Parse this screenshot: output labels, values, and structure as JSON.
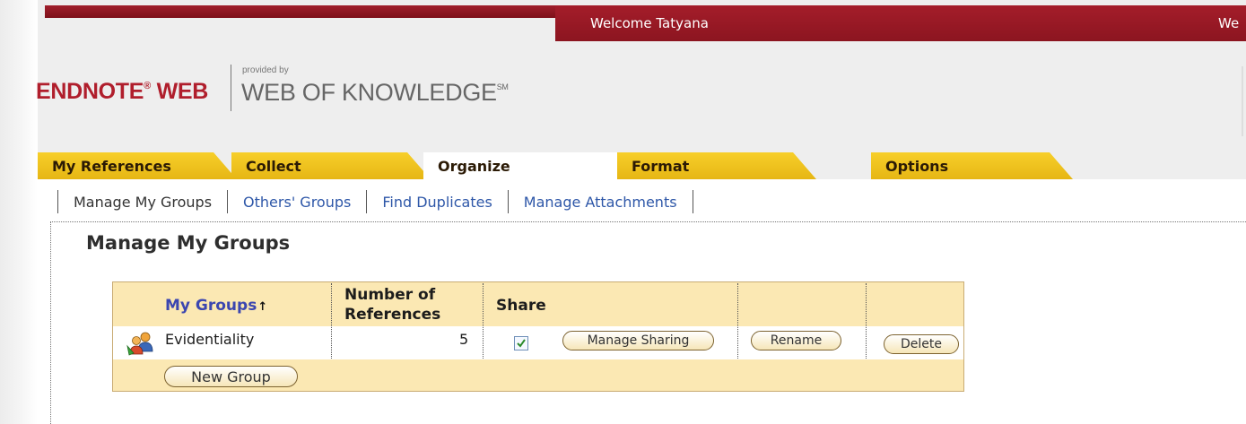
{
  "header": {
    "welcome": "Welcome Tatyana",
    "welcome_truncated": "We",
    "logo_endnote": "ENDNOTE",
    "logo_reg": "®",
    "logo_web": " WEB",
    "logo_provided": "provided by",
    "logo_wok": "WEB OF KNOWLEDGE",
    "logo_sm": "SM"
  },
  "tabs": [
    {
      "label": "My References",
      "active": false
    },
    {
      "label": "Collect",
      "active": false
    },
    {
      "label": "Organize",
      "active": true
    },
    {
      "label": "Format",
      "active": false
    },
    {
      "label": "Options",
      "active": false
    }
  ],
  "subnav": [
    {
      "label": "Manage My Groups",
      "current": true
    },
    {
      "label": "Others' Groups",
      "current": false
    },
    {
      "label": "Find Duplicates",
      "current": false
    },
    {
      "label": "Manage Attachments",
      "current": false
    }
  ],
  "page_title": "Manage My Groups",
  "table": {
    "headers": {
      "my_groups": "My Groups",
      "sort_arrow": "🠕",
      "num_refs_line1": "Number of",
      "num_refs_line2": "References",
      "share": "Share"
    },
    "rows": [
      {
        "name": "Evidentiality",
        "count": "5",
        "shared": true,
        "manage_sharing": "Manage Sharing",
        "rename": "Rename",
        "delete": "Delete"
      }
    ],
    "new_group": "New Group"
  },
  "colors": {
    "brand_red": "#b01e2c",
    "tab_yellow": "#f7cf2a",
    "link_blue": "#2e57a8",
    "table_bg": "#fbe8b3"
  }
}
